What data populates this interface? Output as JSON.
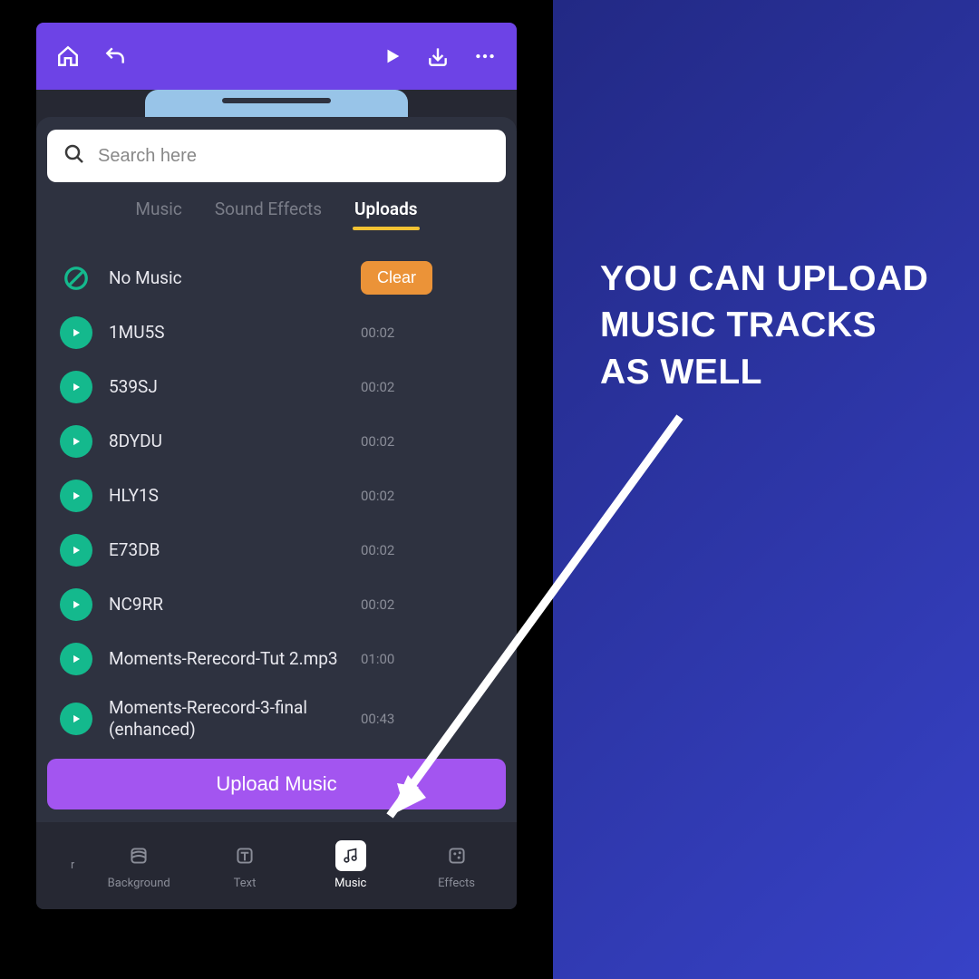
{
  "topbar": {
    "home_icon": "home-icon",
    "undo_icon": "undo-icon",
    "play_icon": "play-icon",
    "download_icon": "download-icon",
    "more_icon": "more-icon"
  },
  "search": {
    "placeholder": "Search here",
    "value": ""
  },
  "tabs": [
    {
      "label": "Music",
      "active": false
    },
    {
      "label": "Sound Effects",
      "active": false
    },
    {
      "label": "Uploads",
      "active": true
    }
  ],
  "no_music": {
    "label": "No Music",
    "clear_label": "Clear"
  },
  "tracks": [
    {
      "title": "1MU5S",
      "duration": "00:02"
    },
    {
      "title": "539SJ",
      "duration": "00:02"
    },
    {
      "title": "8DYDU",
      "duration": "00:02"
    },
    {
      "title": "HLY1S",
      "duration": "00:02"
    },
    {
      "title": "E73DB",
      "duration": "00:02"
    },
    {
      "title": "NC9RR",
      "duration": "00:02"
    },
    {
      "title": "Moments-Rerecord-Tut 2.mp3",
      "duration": "01:00"
    },
    {
      "title": "Moments-Rerecord-3-final (enhanced)",
      "duration": "00:43"
    }
  ],
  "upload_button": "Upload Music",
  "bottom_nav": {
    "partial_label": "r",
    "items": [
      {
        "label": "Background",
        "icon": "layers-icon",
        "active": false
      },
      {
        "label": "Text",
        "icon": "text-icon",
        "active": false
      },
      {
        "label": "Music",
        "icon": "music-icon",
        "active": true
      },
      {
        "label": "Effects",
        "icon": "effects-icon",
        "active": false
      }
    ]
  },
  "callout": {
    "line1": "YOU CAN UPLOAD",
    "line2": " MUSIC TRACKS",
    "line3": "AS WELL"
  },
  "colors": {
    "accent_purple": "#6d43e6",
    "upload_purple": "#a355f0",
    "teal": "#14b98d",
    "orange": "#eb9338",
    "yellow": "#f3c233",
    "panel": "#2e3240"
  }
}
